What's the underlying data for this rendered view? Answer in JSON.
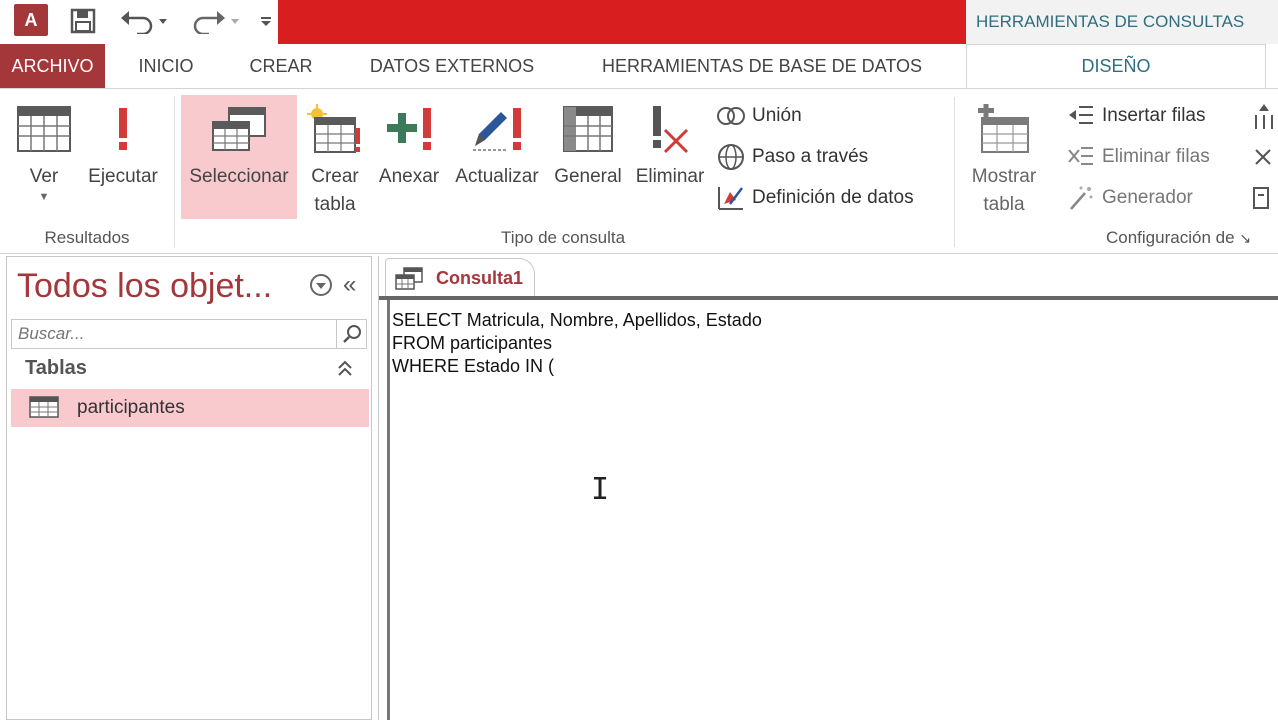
{
  "title_bar": {
    "app_logo_text": "A",
    "contextual_tab_label": "HERRAMIENTAS DE CONSULTAS"
  },
  "tabs": [
    {
      "label": "ARCHIVO"
    },
    {
      "label": "INICIO"
    },
    {
      "label": "CREAR"
    },
    {
      "label": "DATOS EXTERNOS"
    },
    {
      "label": "HERRAMIENTAS DE BASE DE DATOS"
    },
    {
      "label": "DISEÑO"
    }
  ],
  "ribbon": {
    "resultados": {
      "label": "Resultados",
      "ver": "Ver",
      "ejecutar": "Ejecutar"
    },
    "tipo_consulta": {
      "label": "Tipo de consulta",
      "seleccionar": "Seleccionar",
      "crear_line1": "Crear",
      "crear_line2": "tabla",
      "anexar": "Anexar",
      "actualizar": "Actualizar",
      "general": "General",
      "eliminar": "Eliminar",
      "union": "Unión",
      "paso_a_traves": "Paso a través",
      "definicion_datos": "Definición de datos"
    },
    "configuracion": {
      "label": "Configuración de",
      "mostrar_line1": "Mostrar",
      "mostrar_line2": "tabla",
      "insertar_filas": "Insertar filas",
      "eliminar_filas": "Eliminar filas",
      "generador": "Generador"
    }
  },
  "nav_pane": {
    "title": "Todos los objet...",
    "search_placeholder": "Buscar...",
    "group_label": "Tablas",
    "items": [
      {
        "label": "participantes"
      }
    ]
  },
  "document": {
    "tab_label": "Consulta1",
    "sql_lines": [
      "SELECT Matricula, Nombre, Apellidos, Estado",
      "FROM participantes",
      "WHERE Estado IN ("
    ]
  },
  "colors": {
    "access_red": "#a4373a",
    "selected_pink": "#f8c9cd",
    "contextual_teal": "#2e6e7e",
    "title_red_bar": "#d81e1e"
  }
}
